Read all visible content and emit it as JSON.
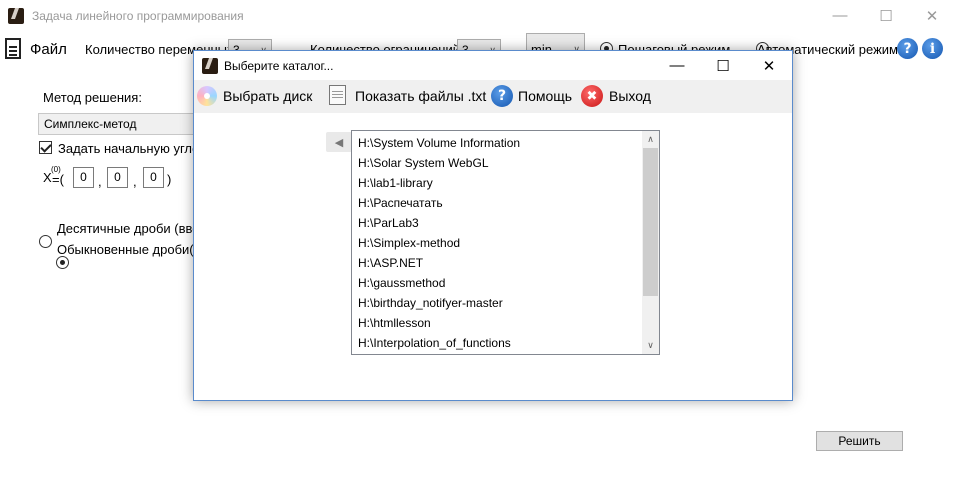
{
  "main": {
    "title": "Задача линейного программирования",
    "menu": {
      "file_label": "Файл",
      "var_count_label": "Количество переменных:",
      "var_count_value": "3",
      "constraint_count_label": "Количество ограничений:",
      "constraint_count_value": "3",
      "objective_value": "min",
      "step_mode_label": "Пошаговый режим",
      "auto_mode_label": "Автоматический режим",
      "help_glyph": "?",
      "info_glyph": "i"
    },
    "method_label": "Метод решения:",
    "method_value": "Симплекс-метод",
    "initial_point_label": "Задать начальную угловую точку",
    "initial_point_prefix": "X",
    "initial_point_superscript": "(0)",
    "initial_point_open": "=(",
    "initial_point_values": [
      "0",
      "0",
      "0"
    ],
    "initial_point_comma": ",",
    "initial_point_close": ")",
    "fraction_decimal_label": "Десятичные дроби (ввод",
    "fraction_common_label": "Обыкновенные дроби(вв",
    "solve_label": "Решить"
  },
  "dialog": {
    "title": "Выберите каталог...",
    "toolbar": {
      "choose_disk": "Выбрать диск",
      "show_txt": "Показать файлы .txt",
      "help": "Помощь",
      "exit": "Выход",
      "help_glyph": "?",
      "exit_glyph": "✖"
    },
    "back_glyph": "◀",
    "items": [
      "H:\\System Volume Information",
      "H:\\Solar System WebGL",
      "H:\\lab1-library",
      "H:\\Распечатать",
      "H:\\ParLab3",
      "H:\\Simplex-method",
      "H:\\ASP.NET",
      "H:\\gaussmethod",
      "H:\\birthday_notifyer-master",
      "H:\\htmllesson",
      "H:\\Interpolation_of_functions"
    ]
  },
  "colors": {
    "help_blue": "#1456b0",
    "exit_red": "#c81414",
    "dialog_border": "#5a8bcc"
  },
  "icons": {
    "app": "app-icon",
    "file": "document-icon",
    "help": "help-icon",
    "info": "info-icon",
    "disk": "disk-icon",
    "txt": "text-file-icon",
    "exit": "close-red-icon",
    "back": "back-arrow-icon"
  }
}
